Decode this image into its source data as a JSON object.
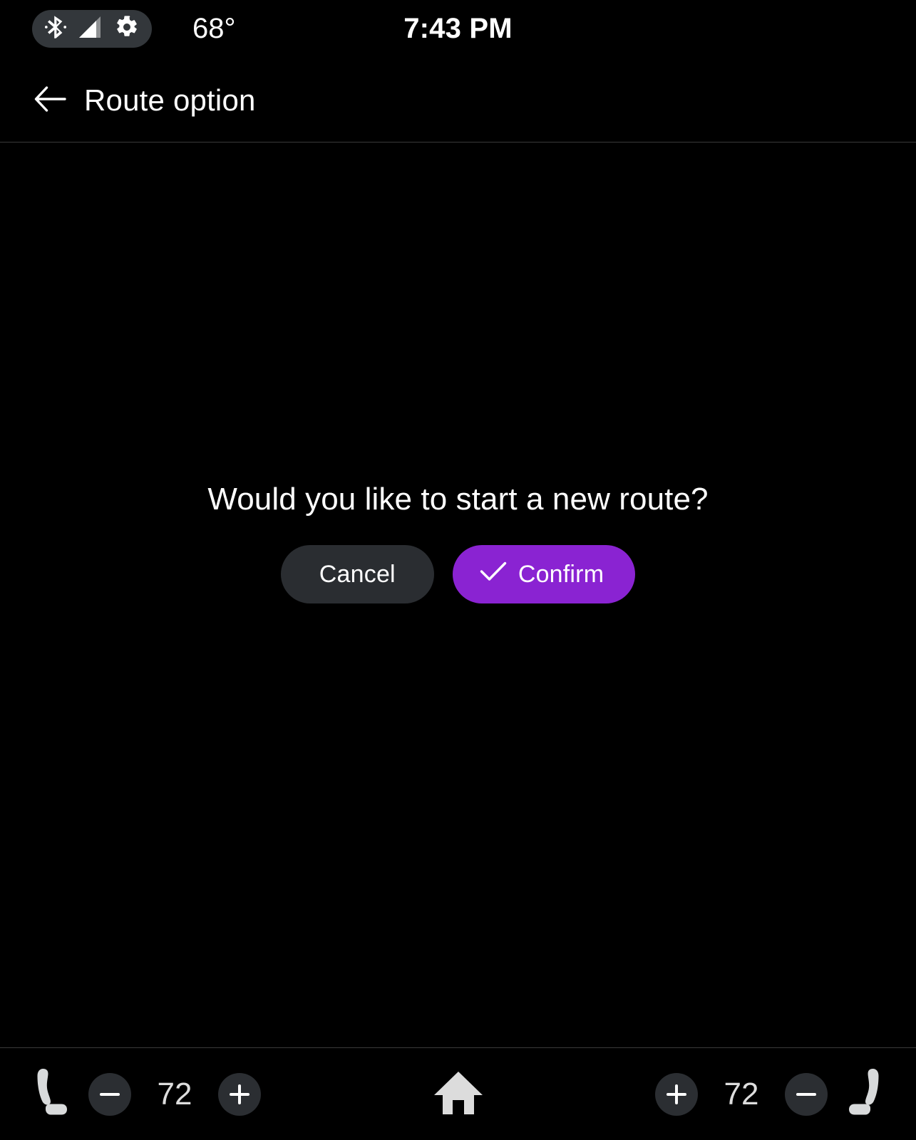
{
  "status_bar": {
    "icons": [
      {
        "name": "bluetooth-icon",
        "label": "Bluetooth"
      },
      {
        "name": "cell-signal-icon",
        "label": "Cellular signal"
      },
      {
        "name": "gear-icon",
        "label": "Settings"
      }
    ],
    "temperature": "68°",
    "time": "7:43 PM"
  },
  "title_bar": {
    "back_icon": "arrow-left-icon",
    "title": "Route option"
  },
  "dialog": {
    "message": "Would you like to start a new route?",
    "cancel_label": "Cancel",
    "confirm_label": "Confirm",
    "confirm_icon": "check-icon"
  },
  "bottom_bar": {
    "left_climate": {
      "seat_icon": "seat-icon",
      "decrease_label": "−",
      "temperature": "72",
      "increase_label": "+"
    },
    "home_icon": "home-icon",
    "right_climate": {
      "increase_label": "+",
      "temperature": "72",
      "decrease_label": "−",
      "seat_icon": "seat-icon"
    }
  },
  "colors": {
    "background": "#000000",
    "accent_purple": "#8a23d2",
    "surface_dark": "#2a2d31",
    "status_pill": "#33373b",
    "divider": "#3a3a3a",
    "text_primary": "#ffffff",
    "text_secondary": "#dddddd"
  }
}
